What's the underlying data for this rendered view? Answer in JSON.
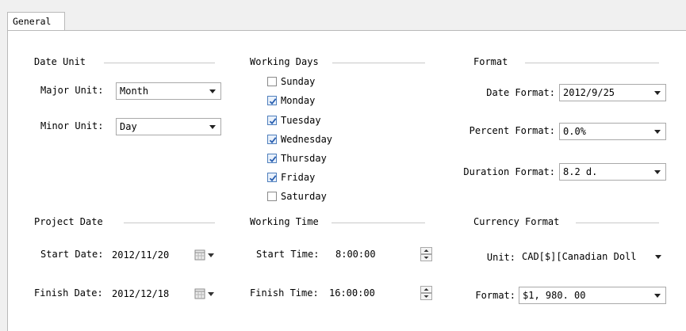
{
  "tabs": {
    "general": "General"
  },
  "date_unit": {
    "title": "Date Unit",
    "major_label": "Major Unit:",
    "major_value": "Month",
    "minor_label": "Minor Unit:",
    "minor_value": "Day"
  },
  "working_days": {
    "title": "Working Days",
    "days": [
      {
        "label": "Sunday",
        "checked": false
      },
      {
        "label": "Monday",
        "checked": true
      },
      {
        "label": "Tuesday",
        "checked": true
      },
      {
        "label": "Wednesday",
        "checked": true
      },
      {
        "label": "Thursday",
        "checked": true
      },
      {
        "label": "Friday",
        "checked": true
      },
      {
        "label": "Saturday",
        "checked": false
      }
    ]
  },
  "format": {
    "title": "Format",
    "date_label": "Date Format:",
    "date_value": "2012/9/25",
    "percent_label": "Percent Format:",
    "percent_value": "0.0%",
    "duration_label": "Duration Format:",
    "duration_value": "8.2 d."
  },
  "project_date": {
    "title": "Project Date",
    "start_label": "Start Date:",
    "start_value": "2012/11/20",
    "finish_label": "Finish Date:",
    "finish_value": "2012/12/18"
  },
  "working_time": {
    "title": "Working Time",
    "start_label": "Start Time:",
    "start_value": "8:00:00",
    "finish_label": "Finish Time:",
    "finish_value": "16:00:00"
  },
  "currency_format": {
    "title": "Currency Format",
    "unit_label": "Unit:",
    "unit_value": "CAD[$][Canadian Doll",
    "format_label": "Format:",
    "format_value": "$1, 980. 00"
  },
  "icons": {
    "dropdown": "chevron-down-icon",
    "calendar": "calendar-icon",
    "spinner": "spinner-icon"
  },
  "colors": {
    "check": "#2a5fb0",
    "border": "#a9a9a9"
  }
}
